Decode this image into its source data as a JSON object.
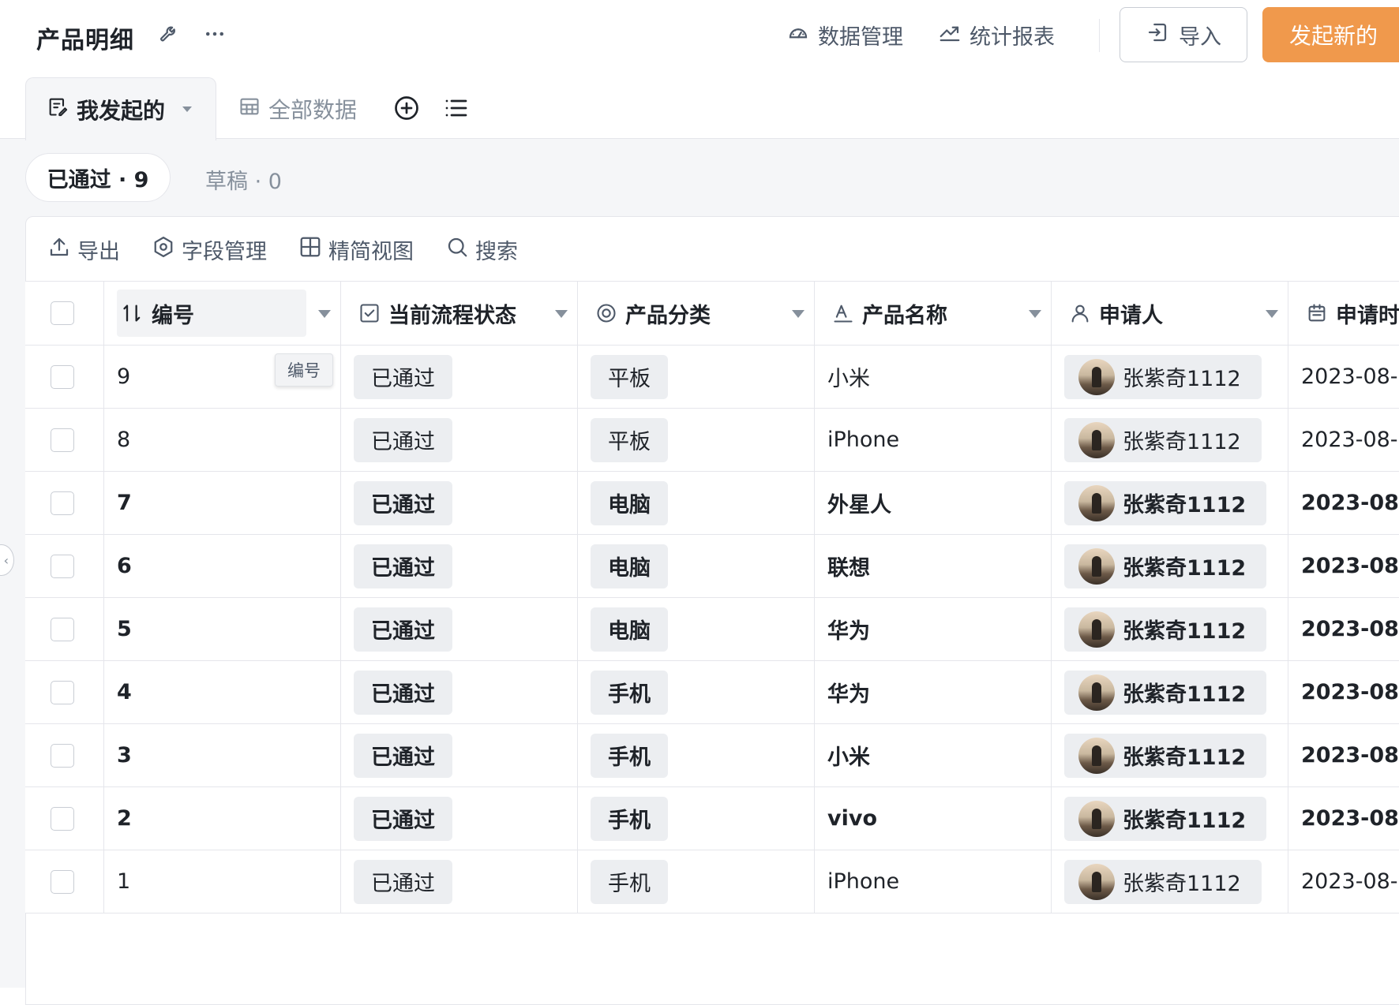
{
  "header": {
    "title": "产品明细",
    "data_management": "数据管理",
    "reports": "统计报表",
    "import": "导入",
    "start_new": "发起新的"
  },
  "tabs": {
    "active": "我发起的",
    "all_data": "全部数据"
  },
  "filters": {
    "approved": "已通过 · 9",
    "draft": "草稿 · 0"
  },
  "toolbar": {
    "export": "导出",
    "fields": "字段管理",
    "compact": "精简视图",
    "search": "搜索"
  },
  "columns": {
    "id": "编号",
    "status": "当前流程状态",
    "category": "产品分类",
    "name": "产品名称",
    "applicant": "申请人",
    "date": "申请时间"
  },
  "tooltip": "编号",
  "rows": [
    {
      "id": "9",
      "status": "已通过",
      "category": "平板",
      "name": "小米",
      "applicant": "张紫奇1112",
      "date": "2023-08-",
      "bold": false
    },
    {
      "id": "8",
      "status": "已通过",
      "category": "平板",
      "name": "iPhone",
      "applicant": "张紫奇1112",
      "date": "2023-08-",
      "bold": false
    },
    {
      "id": "7",
      "status": "已通过",
      "category": "电脑",
      "name": "外星人",
      "applicant": "张紫奇1112",
      "date": "2023-08",
      "bold": true
    },
    {
      "id": "6",
      "status": "已通过",
      "category": "电脑",
      "name": "联想",
      "applicant": "张紫奇1112",
      "date": "2023-08",
      "bold": true
    },
    {
      "id": "5",
      "status": "已通过",
      "category": "电脑",
      "name": "华为",
      "applicant": "张紫奇1112",
      "date": "2023-08",
      "bold": true
    },
    {
      "id": "4",
      "status": "已通过",
      "category": "手机",
      "name": "华为",
      "applicant": "张紫奇1112",
      "date": "2023-08",
      "bold": true
    },
    {
      "id": "3",
      "status": "已通过",
      "category": "手机",
      "name": "小米",
      "applicant": "张紫奇1112",
      "date": "2023-08",
      "bold": true
    },
    {
      "id": "2",
      "status": "已通过",
      "category": "手机",
      "name": "vivo",
      "applicant": "张紫奇1112",
      "date": "2023-08",
      "bold": true
    },
    {
      "id": "1",
      "status": "已通过",
      "category": "手机",
      "name": "iPhone",
      "applicant": "张紫奇1112",
      "date": "2023-08-",
      "bold": false
    }
  ],
  "colors": {
    "accent": "#f0994c",
    "border": "#e5e6eb",
    "tag_bg": "#eceef1"
  }
}
